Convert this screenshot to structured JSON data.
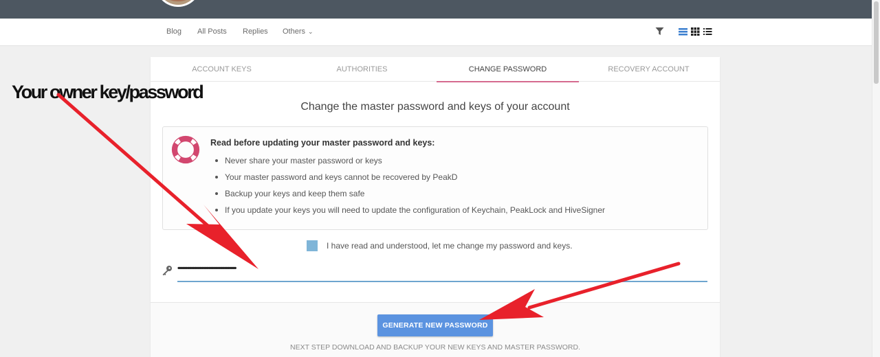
{
  "navbar": {
    "items": [
      {
        "label": "Blog"
      },
      {
        "label": "All Posts"
      },
      {
        "label": "Replies"
      },
      {
        "label": "Others"
      }
    ],
    "icons": [
      "filter-icon",
      "view-list-icon",
      "view-grid-icon",
      "view-compact-icon"
    ]
  },
  "tabs": [
    {
      "label": "ACCOUNT KEYS",
      "active": false
    },
    {
      "label": "AUTHORITIES",
      "active": false
    },
    {
      "label": "CHANGE PASSWORD",
      "active": true
    },
    {
      "label": "RECOVERY ACCOUNT",
      "active": false
    }
  ],
  "main": {
    "heading": "Change the master password and keys of your account",
    "notice": {
      "title": "Read before updating your master password and keys:",
      "items": [
        "Never share your master password or keys",
        "Your master password and keys cannot be recovered by PeakD",
        "Backup your keys and keep them safe",
        "If you update your keys you will need to update the configuration of Keychain, PeakLock and HiveSigner"
      ]
    },
    "agree_label": "I have read and understood, let me change my password and keys.",
    "agree_checked": true,
    "password_dots": "•••••••••••••••••••••••••••••••••••••••••••••••••••",
    "generate_button": "GENERATE NEW PASSWORD",
    "next_step": "NEXT STEP DOWNLOAD AND BACKUP YOUR NEW KEYS AND MASTER PASSWORD."
  },
  "annotation": {
    "text": "Your owner key/password",
    "arrow_color": "#e8212b"
  },
  "colors": {
    "topbar": "#4d5761",
    "accent_tab": "#d56a8f",
    "button": "#5b93e0",
    "checkbox": "#7fb5d8",
    "lifebuoy": "#d2476f"
  }
}
